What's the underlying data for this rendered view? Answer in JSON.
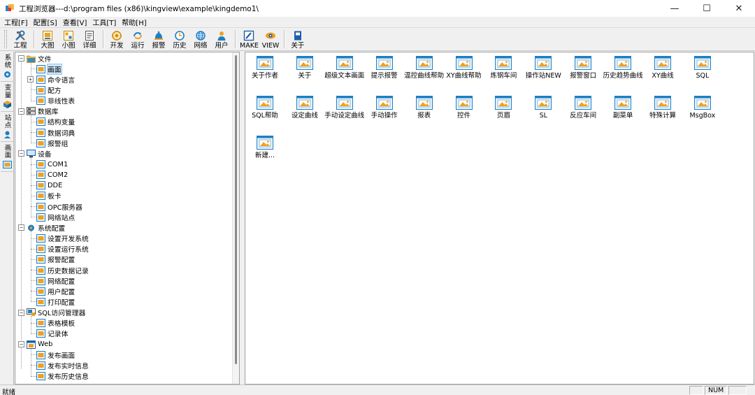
{
  "window": {
    "title": "工程浏览器---d:\\program files (x86)\\kingview\\example\\kingdemo1\\",
    "minimize": "—",
    "maximize": "☐",
    "close": "✕"
  },
  "menu": [
    "工程[F]",
    "配置[S]",
    "查看[V]",
    "工具[T]",
    "帮助[H]"
  ],
  "toolbar": {
    "groups": [
      [
        {
          "label": "工程",
          "icon": "tools-icon"
        }
      ],
      [
        {
          "label": "大图",
          "icon": "large-icons-icon"
        },
        {
          "label": "小图",
          "icon": "small-icons-icon"
        },
        {
          "label": "详细",
          "icon": "details-icon"
        }
      ],
      [
        {
          "label": "开发",
          "icon": "develop-icon"
        },
        {
          "label": "运行",
          "icon": "run-icon"
        },
        {
          "label": "报警",
          "icon": "alarm-icon"
        },
        {
          "label": "历史",
          "icon": "history-icon"
        },
        {
          "label": "网络",
          "icon": "network-icon"
        },
        {
          "label": "用户",
          "icon": "user-icon"
        }
      ],
      [
        {
          "label": "MAKE",
          "icon": "make-icon"
        },
        {
          "label": "VIEW",
          "icon": "view-icon"
        }
      ],
      [
        {
          "label": "关于",
          "icon": "about-icon"
        }
      ]
    ]
  },
  "vtabs": [
    {
      "label": "系统",
      "icon": "gear-icon"
    },
    {
      "label": "变量",
      "icon": "cube-icon"
    },
    {
      "label": "站点",
      "icon": "station-icon"
    },
    {
      "label": "画面",
      "icon": "picture-icon"
    }
  ],
  "tree": {
    "groups": [
      {
        "label": "文件",
        "icon": "folder-icon",
        "children": [
          {
            "label": "画面",
            "icon": "picture-icon",
            "selected": true
          },
          {
            "label": "命令语言",
            "icon": "command-icon",
            "expandable": true
          },
          {
            "label": "配方",
            "icon": "recipe-icon"
          },
          {
            "label": "非线性表",
            "icon": "table-icon"
          }
        ]
      },
      {
        "label": "数据库",
        "icon": "database-icon",
        "children": [
          {
            "label": "结构变量",
            "icon": "struct-icon"
          },
          {
            "label": "数据词典",
            "icon": "dictionary-icon"
          },
          {
            "label": "报警组",
            "icon": "alarm-group-icon"
          }
        ]
      },
      {
        "label": "设备",
        "icon": "monitor-icon",
        "children": [
          {
            "label": "COM1",
            "icon": "com-port-icon"
          },
          {
            "label": "COM2",
            "icon": "com-port-icon"
          },
          {
            "label": "DDE",
            "icon": "dde-icon"
          },
          {
            "label": "板卡",
            "icon": "board-icon"
          },
          {
            "label": "OPC服务器",
            "icon": "opc-icon"
          },
          {
            "label": "网络站点",
            "icon": "network-station-icon"
          }
        ]
      },
      {
        "label": "系统配置",
        "icon": "system-config-icon",
        "children": [
          {
            "label": "设置开发系统",
            "icon": "develop-icon"
          },
          {
            "label": "设置运行系统",
            "icon": "run-icon"
          },
          {
            "label": "报警配置",
            "icon": "alarm-icon"
          },
          {
            "label": "历史数据记录",
            "icon": "history-icon"
          },
          {
            "label": "网络配置",
            "icon": "network-icon"
          },
          {
            "label": "用户配置",
            "icon": "user-icon"
          },
          {
            "label": "打印配置",
            "icon": "print-icon"
          }
        ]
      },
      {
        "label": "SQL访问管理器",
        "icon": "sql-manager-icon",
        "children": [
          {
            "label": "表格模板",
            "icon": "grid-icon"
          },
          {
            "label": "记录体",
            "icon": "record-icon"
          }
        ]
      },
      {
        "label": "Web",
        "icon": "web-icon",
        "children": [
          {
            "label": "发布画面",
            "icon": "publish-icon"
          },
          {
            "label": "发布实时信息",
            "icon": "publish-icon"
          },
          {
            "label": "发布历史信息",
            "icon": "publish-history-icon"
          }
        ]
      }
    ]
  },
  "content": {
    "items": [
      "关于作者",
      "关于",
      "超级文本画面",
      "提示报警",
      "温控曲线帮助",
      "XY曲线帮助",
      "炼钢车间",
      "操作站NEW",
      "报警窗口",
      "历史趋势曲线",
      "XY曲线",
      "SQL",
      "SQL帮助",
      "设定曲线",
      "手动设定曲线",
      "手动操作",
      "报表",
      "控件",
      "页眉",
      "SL",
      "反应车间",
      "副菜单",
      "特殊计算",
      "MsgBox",
      "新建..."
    ]
  },
  "status": {
    "text": "就绪",
    "num": "NUM"
  },
  "colors": {
    "icon_blue": "#1d7fc4",
    "icon_orange": "#f0a020",
    "selection": "#cce4f7"
  }
}
